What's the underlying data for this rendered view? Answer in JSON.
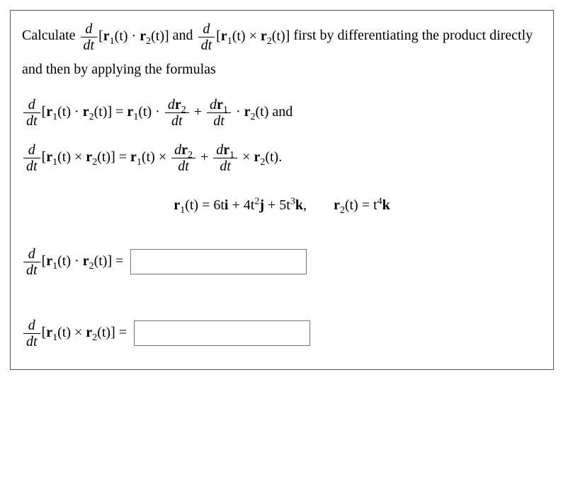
{
  "problem": {
    "intro_prefix": "Calculate ",
    "d": "d",
    "dt": "dt",
    "r1": "r",
    "r2": "r",
    "sub1": "1",
    "sub2": "2",
    "of_t": "(t)",
    "dot_op": " · ",
    "cross_op": " × ",
    "and_word": " and ",
    "intro_tail": " first by differentiating the product directly and then by applying the formulas",
    "eq": " = ",
    "plus": " + ",
    "and_end": " and",
    "period": ".",
    "given_r1_prefix": "(t) = 6t",
    "given_r1_mid": " + 4t",
    "given_r1_tail": " + 5t",
    "given_r2_prefix": "(t) = t",
    "ihat": "i",
    "jhat": "j",
    "khat": "k",
    "comma_sep": ",",
    "exp2": "2",
    "exp3": "3",
    "exp4": "4",
    "open_br": "[",
    "close_br": "]",
    "answer_dot_placeholder": "",
    "answer_cross_placeholder": ""
  }
}
